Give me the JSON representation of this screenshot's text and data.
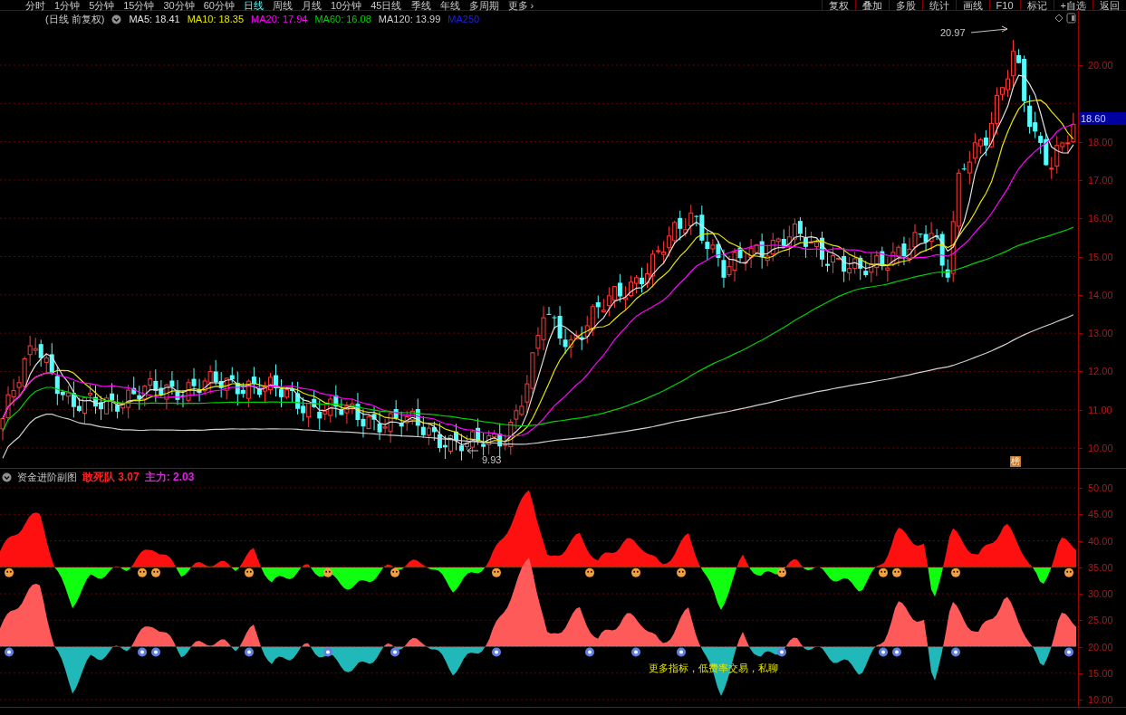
{
  "toolbar": {
    "period_tabs": [
      {
        "label": "分时",
        "selected": false
      },
      {
        "label": "1分钟",
        "selected": false
      },
      {
        "label": "5分钟",
        "selected": false
      },
      {
        "label": "15分钟",
        "selected": false
      },
      {
        "label": "30分钟",
        "selected": false
      },
      {
        "label": "60分钟",
        "selected": false
      },
      {
        "label": "日线",
        "selected": true
      },
      {
        "label": "周线",
        "selected": false
      },
      {
        "label": "月线",
        "selected": false
      },
      {
        "label": "10分钟",
        "selected": false
      },
      {
        "label": "45日线",
        "selected": false
      },
      {
        "label": "季线",
        "selected": false
      },
      {
        "label": "年线",
        "selected": false
      },
      {
        "label": "多周期",
        "selected": false
      },
      {
        "label": "更多 ›",
        "selected": false
      }
    ],
    "tools": [
      "复权",
      "叠加",
      "多股",
      "统计",
      "画线",
      "F10",
      "标记",
      "+自选",
      "返回"
    ]
  },
  "main_chart": {
    "legend_title": "(日线 前复权)",
    "indicators": [
      {
        "label": "MA5: 18.41",
        "color": "#e0e0e0"
      },
      {
        "label": "MA10: 18.35",
        "color": "#e6e600"
      },
      {
        "label": "MA20: 17.94",
        "color": "#ff00ff"
      },
      {
        "label": "MA60: 16.08",
        "color": "#00d000"
      },
      {
        "label": "MA120: 13.99",
        "color": "#d0d0d0"
      },
      {
        "label": "MA250",
        "color": "#2020e0"
      }
    ],
    "y_axis": [
      "20.00",
      "18.00",
      "17.00",
      "16.00",
      "15.00",
      "14.00",
      "13.00",
      "12.00",
      "11.00",
      "10.00"
    ],
    "high_label": "20.97",
    "low_label": "9.93",
    "price_tag": "18.60",
    "badge": "榜"
  },
  "sub_chart": {
    "title": "资金进阶副图",
    "values": [
      {
        "label": "敢死队 3.07",
        "color": "#ff2020"
      },
      {
        "label": "主力: 2.03",
        "color": "#e020e0"
      }
    ],
    "y_axis": [
      "50.00",
      "45.00",
      "40.00",
      "35.00",
      "30.00",
      "25.00",
      "20.00",
      "15.00",
      "10.00"
    ],
    "note": "更多指标，低费率交易，私聊"
  }
}
